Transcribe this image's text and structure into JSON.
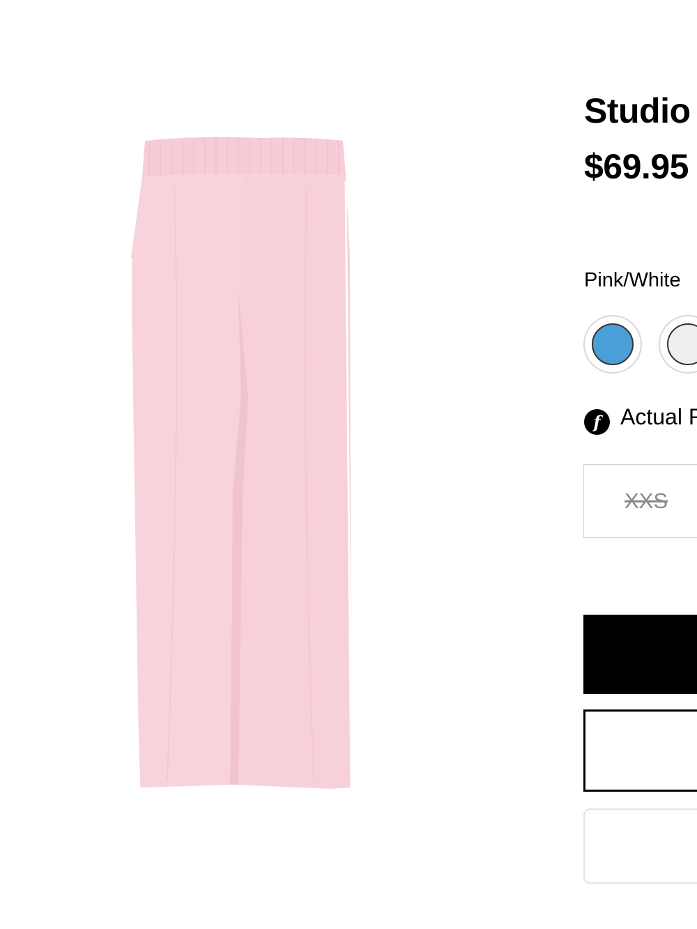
{
  "product": {
    "title": "Studio",
    "price": "$69.95",
    "image_alt": "pink pants with white side stripe"
  },
  "color": {
    "selected_label": "Pink/White",
    "swatches": [
      {
        "name": "blue",
        "hex": "#4a9fd8"
      },
      {
        "name": "white",
        "hex": "#eeeeee"
      }
    ]
  },
  "fit": {
    "icon": "fit-info-icon",
    "icon_glyph": "f",
    "label": "Actual F"
  },
  "sizes": [
    {
      "label": "XXS",
      "available": false
    }
  ],
  "colors": {
    "pants": "#f8d3dc",
    "pants_shade": "#f0c4cf",
    "stripe": "#ffffff",
    "primary_button": "#000000"
  }
}
